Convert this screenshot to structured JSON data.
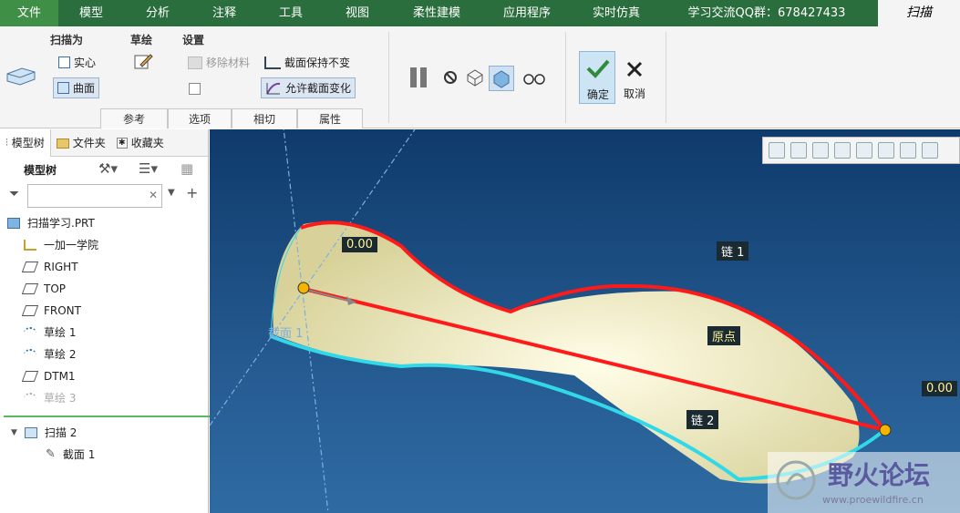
{
  "menubar": {
    "file": "文件",
    "model": "模型",
    "analysis": "分析",
    "annotation": "注释",
    "tools": "工具",
    "view": "视图",
    "flex": "柔性建模",
    "apps": "应用程序",
    "sim": "实时仿真",
    "qq": "学习交流QQ群：678427433",
    "sweep": "扫描"
  },
  "ribbon": {
    "sweep_as": "扫描为",
    "solid": "实心",
    "surface": "曲面",
    "sketch": "草绘",
    "settings": "设置",
    "remove_material": "移除材料",
    "section_constant": "截面保持不变",
    "allow_section_change": "允许截面变化",
    "ok": "确定",
    "cancel": "取消",
    "tabs": [
      "参考",
      "选项",
      "相切",
      "属性"
    ]
  },
  "left": {
    "tab_tree": "模型树",
    "tab_folder": "文件夹",
    "tab_fav": "收藏夹",
    "tree_label": "模型树",
    "items": [
      "扫描学习.PRT",
      "一加一学院",
      "RIGHT",
      "TOP",
      "FRONT",
      "草绘 1",
      "草绘 2",
      "DTM1",
      "草绘 3"
    ],
    "sweep": "扫描 2",
    "section": "截面 1"
  },
  "viewport": {
    "val1": "0.00",
    "val2": "0.00",
    "chain1": "链 1",
    "chain2": "链 2",
    "origin": "原点",
    "section": "截面 1",
    "wm_title": "野火论坛",
    "wm_url": "www.proewildfire.cn"
  }
}
